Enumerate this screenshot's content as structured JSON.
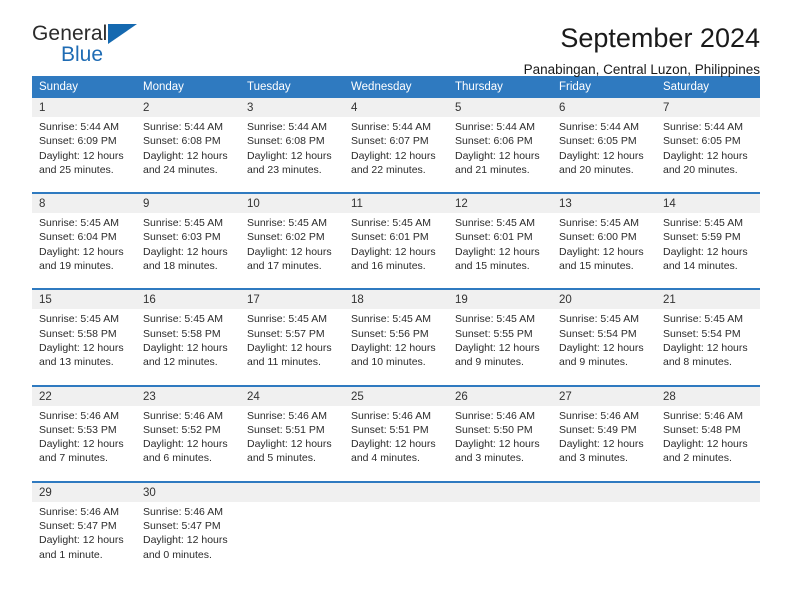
{
  "logo": {
    "word1": "General",
    "word2": "Blue",
    "triangle_color": "#1569b0"
  },
  "header": {
    "title": "September 2024",
    "subtitle": "Panabingan, Central Luzon, Philippines",
    "accent_color": "#2f7ac0",
    "daynum_band_color": "#f0f0f0"
  },
  "calendar": {
    "weekday_headers": [
      "Sunday",
      "Monday",
      "Tuesday",
      "Wednesday",
      "Thursday",
      "Friday",
      "Saturday"
    ],
    "weeks": [
      [
        {
          "day": "1",
          "lines": [
            "Sunrise: 5:44 AM",
            "Sunset: 6:09 PM",
            "Daylight: 12 hours",
            "and 25 minutes."
          ]
        },
        {
          "day": "2",
          "lines": [
            "Sunrise: 5:44 AM",
            "Sunset: 6:08 PM",
            "Daylight: 12 hours",
            "and 24 minutes."
          ]
        },
        {
          "day": "3",
          "lines": [
            "Sunrise: 5:44 AM",
            "Sunset: 6:08 PM",
            "Daylight: 12 hours",
            "and 23 minutes."
          ]
        },
        {
          "day": "4",
          "lines": [
            "Sunrise: 5:44 AM",
            "Sunset: 6:07 PM",
            "Daylight: 12 hours",
            "and 22 minutes."
          ]
        },
        {
          "day": "5",
          "lines": [
            "Sunrise: 5:44 AM",
            "Sunset: 6:06 PM",
            "Daylight: 12 hours",
            "and 21 minutes."
          ]
        },
        {
          "day": "6",
          "lines": [
            "Sunrise: 5:44 AM",
            "Sunset: 6:05 PM",
            "Daylight: 12 hours",
            "and 20 minutes."
          ]
        },
        {
          "day": "7",
          "lines": [
            "Sunrise: 5:44 AM",
            "Sunset: 6:05 PM",
            "Daylight: 12 hours",
            "and 20 minutes."
          ]
        }
      ],
      [
        {
          "day": "8",
          "lines": [
            "Sunrise: 5:45 AM",
            "Sunset: 6:04 PM",
            "Daylight: 12 hours",
            "and 19 minutes."
          ]
        },
        {
          "day": "9",
          "lines": [
            "Sunrise: 5:45 AM",
            "Sunset: 6:03 PM",
            "Daylight: 12 hours",
            "and 18 minutes."
          ]
        },
        {
          "day": "10",
          "lines": [
            "Sunrise: 5:45 AM",
            "Sunset: 6:02 PM",
            "Daylight: 12 hours",
            "and 17 minutes."
          ]
        },
        {
          "day": "11",
          "lines": [
            "Sunrise: 5:45 AM",
            "Sunset: 6:01 PM",
            "Daylight: 12 hours",
            "and 16 minutes."
          ]
        },
        {
          "day": "12",
          "lines": [
            "Sunrise: 5:45 AM",
            "Sunset: 6:01 PM",
            "Daylight: 12 hours",
            "and 15 minutes."
          ]
        },
        {
          "day": "13",
          "lines": [
            "Sunrise: 5:45 AM",
            "Sunset: 6:00 PM",
            "Daylight: 12 hours",
            "and 15 minutes."
          ]
        },
        {
          "day": "14",
          "lines": [
            "Sunrise: 5:45 AM",
            "Sunset: 5:59 PM",
            "Daylight: 12 hours",
            "and 14 minutes."
          ]
        }
      ],
      [
        {
          "day": "15",
          "lines": [
            "Sunrise: 5:45 AM",
            "Sunset: 5:58 PM",
            "Daylight: 12 hours",
            "and 13 minutes."
          ]
        },
        {
          "day": "16",
          "lines": [
            "Sunrise: 5:45 AM",
            "Sunset: 5:58 PM",
            "Daylight: 12 hours",
            "and 12 minutes."
          ]
        },
        {
          "day": "17",
          "lines": [
            "Sunrise: 5:45 AM",
            "Sunset: 5:57 PM",
            "Daylight: 12 hours",
            "and 11 minutes."
          ]
        },
        {
          "day": "18",
          "lines": [
            "Sunrise: 5:45 AM",
            "Sunset: 5:56 PM",
            "Daylight: 12 hours",
            "and 10 minutes."
          ]
        },
        {
          "day": "19",
          "lines": [
            "Sunrise: 5:45 AM",
            "Sunset: 5:55 PM",
            "Daylight: 12 hours",
            "and 9 minutes."
          ]
        },
        {
          "day": "20",
          "lines": [
            "Sunrise: 5:45 AM",
            "Sunset: 5:54 PM",
            "Daylight: 12 hours",
            "and 9 minutes."
          ]
        },
        {
          "day": "21",
          "lines": [
            "Sunrise: 5:45 AM",
            "Sunset: 5:54 PM",
            "Daylight: 12 hours",
            "and 8 minutes."
          ]
        }
      ],
      [
        {
          "day": "22",
          "lines": [
            "Sunrise: 5:46 AM",
            "Sunset: 5:53 PM",
            "Daylight: 12 hours",
            "and 7 minutes."
          ]
        },
        {
          "day": "23",
          "lines": [
            "Sunrise: 5:46 AM",
            "Sunset: 5:52 PM",
            "Daylight: 12 hours",
            "and 6 minutes."
          ]
        },
        {
          "day": "24",
          "lines": [
            "Sunrise: 5:46 AM",
            "Sunset: 5:51 PM",
            "Daylight: 12 hours",
            "and 5 minutes."
          ]
        },
        {
          "day": "25",
          "lines": [
            "Sunrise: 5:46 AM",
            "Sunset: 5:51 PM",
            "Daylight: 12 hours",
            "and 4 minutes."
          ]
        },
        {
          "day": "26",
          "lines": [
            "Sunrise: 5:46 AM",
            "Sunset: 5:50 PM",
            "Daylight: 12 hours",
            "and 3 minutes."
          ]
        },
        {
          "day": "27",
          "lines": [
            "Sunrise: 5:46 AM",
            "Sunset: 5:49 PM",
            "Daylight: 12 hours",
            "and 3 minutes."
          ]
        },
        {
          "day": "28",
          "lines": [
            "Sunrise: 5:46 AM",
            "Sunset: 5:48 PM",
            "Daylight: 12 hours",
            "and 2 minutes."
          ]
        }
      ],
      [
        {
          "day": "29",
          "lines": [
            "Sunrise: 5:46 AM",
            "Sunset: 5:47 PM",
            "Daylight: 12 hours",
            "and 1 minute."
          ]
        },
        {
          "day": "30",
          "lines": [
            "Sunrise: 5:46 AM",
            "Sunset: 5:47 PM",
            "Daylight: 12 hours",
            "and 0 minutes."
          ]
        },
        {
          "day": "",
          "lines": []
        },
        {
          "day": "",
          "lines": []
        },
        {
          "day": "",
          "lines": []
        },
        {
          "day": "",
          "lines": []
        },
        {
          "day": "",
          "lines": []
        }
      ]
    ]
  }
}
